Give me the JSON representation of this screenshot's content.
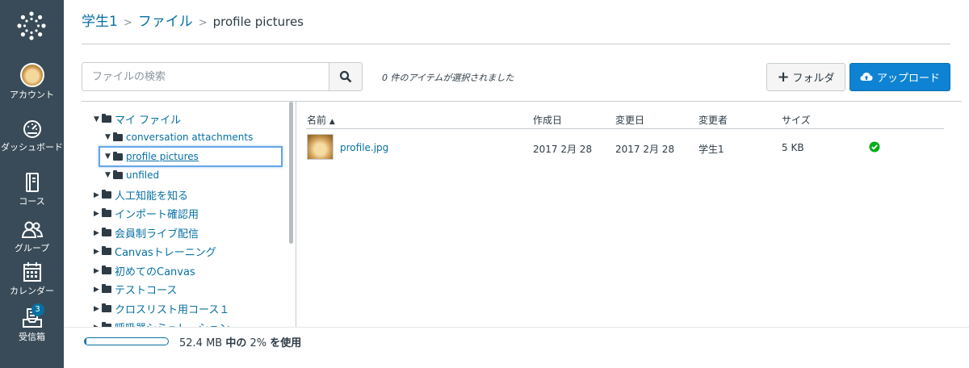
{
  "nav": {
    "items": [
      {
        "label": "アカウント",
        "icon": "avatar"
      },
      {
        "label": "ダッシュボード",
        "icon": "dashboard-icon"
      },
      {
        "label": "コース",
        "icon": "courses-icon"
      },
      {
        "label": "グループ",
        "icon": "groups-icon"
      },
      {
        "label": "カレンダー",
        "icon": "calendar-icon"
      },
      {
        "label": "受信箱",
        "icon": "inbox-icon",
        "badge": "3"
      }
    ]
  },
  "breadcrumb": {
    "course": "学生1",
    "files": "ファイル",
    "current": "profile pictures"
  },
  "toolbar": {
    "search_placeholder": "ファイルの検索",
    "selection_status": "0 件のアイテムが選択されました",
    "folder_label": "フォルダ",
    "upload_label": "アップロード"
  },
  "tree": {
    "root": "マイ ファイル",
    "children": [
      "conversation attachments",
      "profile pictures",
      "unfiled"
    ],
    "courses": [
      "人工知能を知る",
      "インポート確認用",
      "会員制ライブ配信",
      "Canvasトレーニング",
      "初めてのCanvas",
      "テストコース",
      "クロスリスト用コース１",
      "呼吸器シミュレーション"
    ]
  },
  "table": {
    "headers": {
      "name": "名前",
      "created": "作成日",
      "modified": "変更日",
      "modified_by": "変更者",
      "size": "サイズ"
    },
    "rows": [
      {
        "name": "profile.jpg",
        "created": "2017 2月 28",
        "modified": "2017 2月 28",
        "modified_by": "学生1",
        "size": "5 KB",
        "status": "published"
      }
    ]
  },
  "quota": {
    "used_percent": 2,
    "text_total": "52.4 MB",
    "text_mid": "中の",
    "text_pct": "2%",
    "text_end": "を使用"
  },
  "colors": {
    "nav_bg": "#394b58",
    "link": "#0770a3",
    "upload": "#0f83d3",
    "published": "#00ac18"
  }
}
